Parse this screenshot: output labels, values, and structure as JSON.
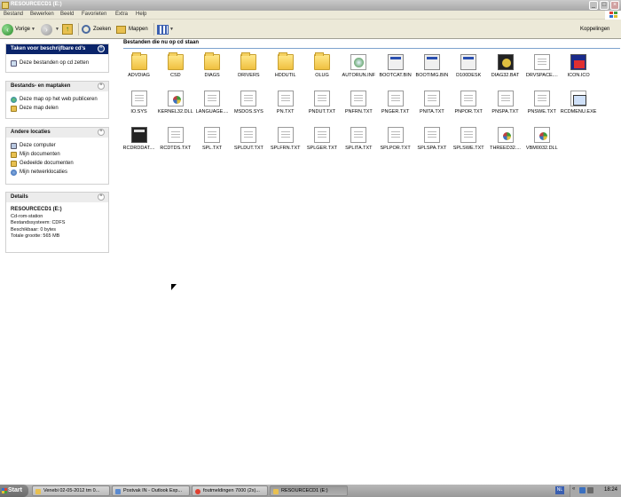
{
  "window": {
    "title": "RESOURCECD1 (E:)"
  },
  "menu": [
    "Bestand",
    "Bewerken",
    "Beeld",
    "Favorieten",
    "Extra",
    "Help"
  ],
  "toolbar": {
    "back": "Vorige",
    "search": "Zoeken",
    "folders": "Mappen",
    "links": "Koppelingen"
  },
  "sidebar": {
    "cd_tasks": {
      "title": "Taken voor beschrijfbare cd's",
      "items": [
        "Deze bestanden op cd zetten"
      ]
    },
    "file_tasks": {
      "title": "Bestands- en maptaken",
      "items": [
        "Deze map op het web publiceren",
        "Deze map delen"
      ]
    },
    "other_places": {
      "title": "Andere locaties",
      "items": [
        "Deze computer",
        "Mijn documenten",
        "Gedeelde documenten",
        "Mijn netwerklocaties"
      ]
    },
    "details": {
      "title": "Details",
      "name": "RESOURCECD1 (E:)",
      "type": "Cd-rom-station",
      "fs": "Bestandssysteem: CDFS",
      "free": "Beschikbaar: 0 bytes",
      "total": "Totale grootte: 565 MB"
    }
  },
  "content": {
    "section_title": "Bestanden die nu op cd staan",
    "files": [
      {
        "name": "ADVDIAG",
        "icon": "folder"
      },
      {
        "name": "CSD",
        "icon": "folder"
      },
      {
        "name": "DIAGS",
        "icon": "folder"
      },
      {
        "name": "DRIVERS",
        "icon": "folder"
      },
      {
        "name": "HDDUTIL",
        "icon": "folder"
      },
      {
        "name": "OLUG",
        "icon": "folder"
      },
      {
        "name": "AUTORUN.INF",
        "icon": "setup"
      },
      {
        "name": "BOOTCAT.BIN",
        "icon": "app"
      },
      {
        "name": "BOOTIMG.BIN",
        "icon": "app"
      },
      {
        "name": "D100DESK",
        "icon": "app"
      },
      {
        "name": "DIAG32.BAT",
        "icon": "bat"
      },
      {
        "name": "DRVSPACE....",
        "icon": "doc"
      },
      {
        "name": "ICON.ICO",
        "icon": "ico"
      },
      {
        "name": "IO.SYS",
        "icon": "doc"
      },
      {
        "name": "KERNEL32.DLL",
        "icon": "dll"
      },
      {
        "name": "LANGUAGE....",
        "icon": "doc"
      },
      {
        "name": "MSDOS.SYS",
        "icon": "doc"
      },
      {
        "name": "PN.TXT",
        "icon": "doc"
      },
      {
        "name": "PNDUT.TXT",
        "icon": "doc"
      },
      {
        "name": "PNFRN.TXT",
        "icon": "doc"
      },
      {
        "name": "PNGER.TXT",
        "icon": "doc"
      },
      {
        "name": "PNITA.TXT",
        "icon": "doc"
      },
      {
        "name": "PNPOR.TXT",
        "icon": "doc"
      },
      {
        "name": "PNSPA.TXT",
        "icon": "doc"
      },
      {
        "name": "PNSWE.TXT",
        "icon": "doc"
      },
      {
        "name": "RCDMENU.EXE",
        "icon": "exe"
      },
      {
        "name": "RCDRDDAT....",
        "icon": "cmd"
      },
      {
        "name": "RCDTDS.TXT",
        "icon": "doc"
      },
      {
        "name": "SPL.TXT",
        "icon": "doc"
      },
      {
        "name": "SPLDUT.TXT",
        "icon": "doc"
      },
      {
        "name": "SPLFRN.TXT",
        "icon": "doc"
      },
      {
        "name": "SPLGER.TXT",
        "icon": "doc"
      },
      {
        "name": "SPLITA.TXT",
        "icon": "doc"
      },
      {
        "name": "SPLPOR.TXT",
        "icon": "doc"
      },
      {
        "name": "SPLSPA.TXT",
        "icon": "doc"
      },
      {
        "name": "SPLSWE.TXT",
        "icon": "doc"
      },
      {
        "name": "THREED32....",
        "icon": "dll"
      },
      {
        "name": "VBM0032.DLL",
        "icon": "dll"
      }
    ]
  },
  "taskbar": {
    "start": "Start",
    "tasks": [
      {
        "label": "Venebi 02-05-2012 tm 0...",
        "color": "#e8c050"
      },
      {
        "label": "Postvak IN - Outlook Exp...",
        "color": "#5a8ad0"
      },
      {
        "label": "foutmeldingen 7000 (2x)...",
        "color": "#e04030"
      },
      {
        "label": "RESOURCECD1 (E:)",
        "color": "#e8c050"
      }
    ],
    "lang": "NL",
    "clock": "18:24"
  }
}
